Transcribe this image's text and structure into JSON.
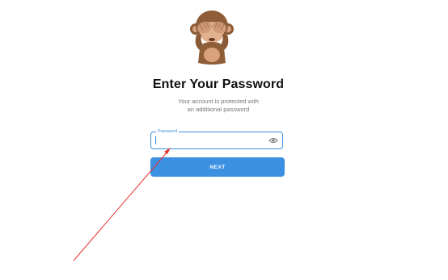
{
  "auth": {
    "title": "Enter Your Password",
    "subtitle_line1": "Your account is protected with",
    "subtitle_line2": "an additional password",
    "password_label": "Password",
    "password_value": "",
    "next_label": "NEXT"
  },
  "icons": {
    "monkey": "see-no-evil-monkey-icon",
    "eye": "eye-icon"
  },
  "colors": {
    "accent": "#3b90e2",
    "annotation": "#e8322e"
  }
}
